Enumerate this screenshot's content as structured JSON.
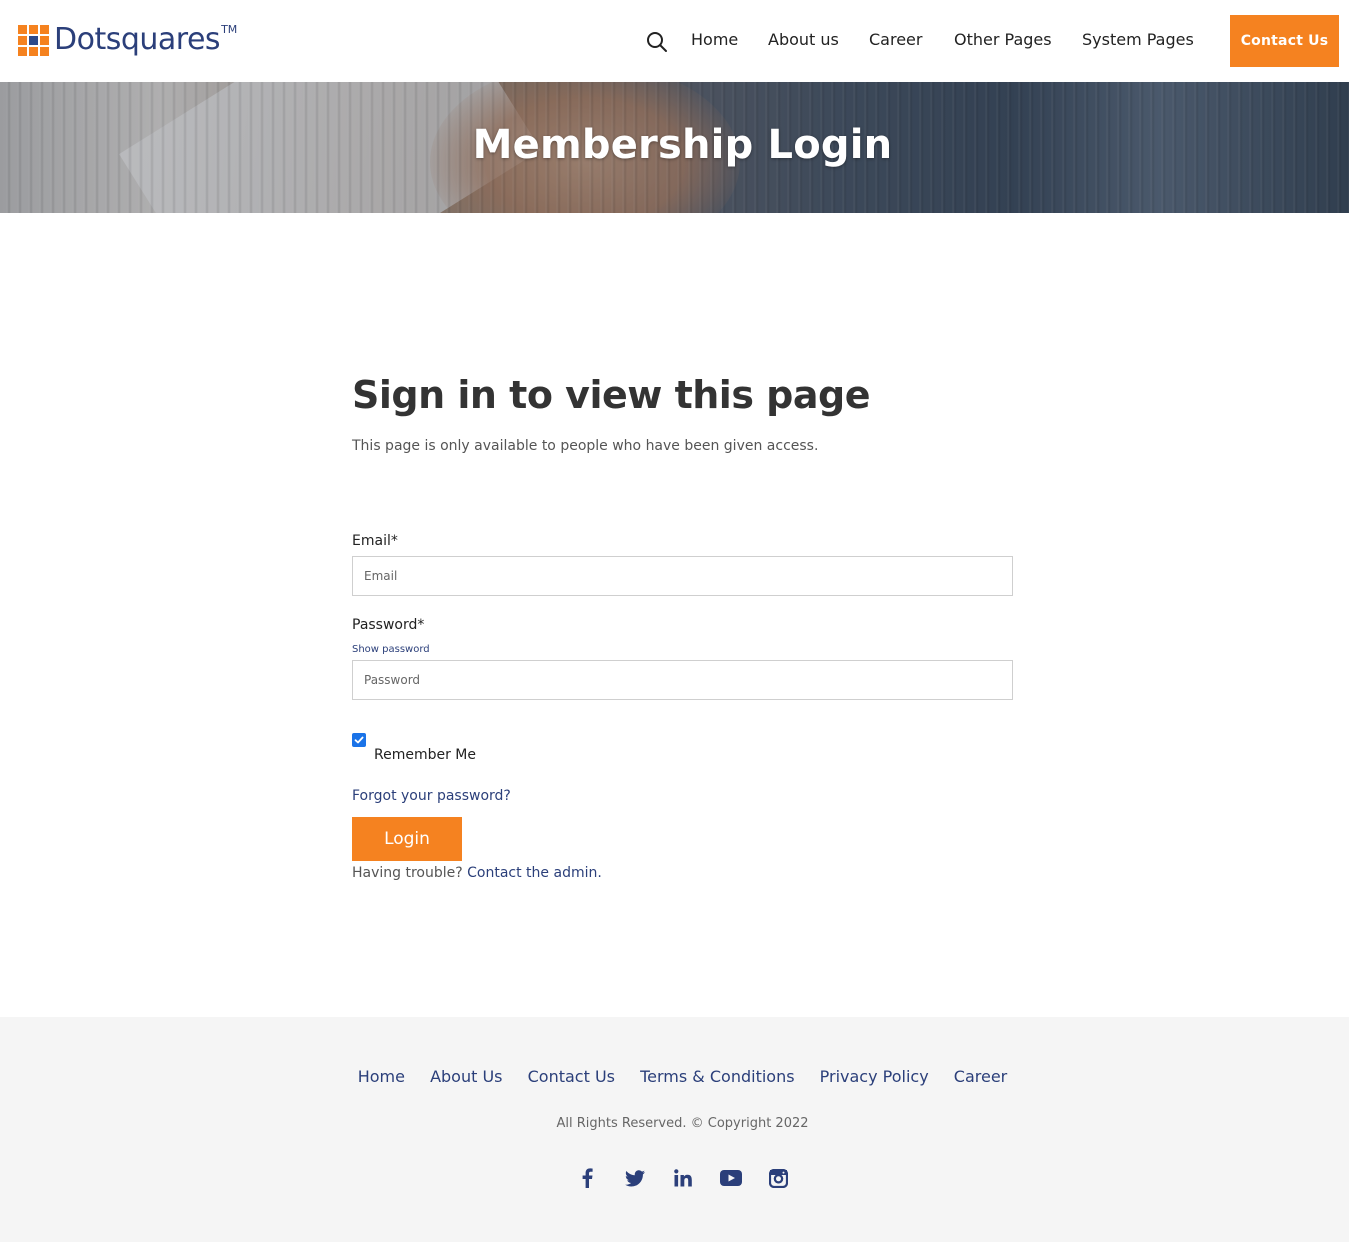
{
  "brand": {
    "name": "Dotsquares",
    "tm": "TM"
  },
  "nav": {
    "items": [
      "Home",
      "About us",
      "Career",
      "Other Pages",
      "System Pages"
    ],
    "contact_label": "Contact Us"
  },
  "banner": {
    "title": "Membership Login"
  },
  "main": {
    "heading": "Sign in to view this page",
    "subtext": "This page is only available to people who have been given access.",
    "email_label": "Email*",
    "email_placeholder": "Email",
    "password_label": "Password*",
    "show_password": "Show password",
    "password_placeholder": "Password",
    "remember_label": "Remember Me",
    "remember_checked": true,
    "forgot_label": "Forgot your password?",
    "login_label": "Login",
    "trouble_text": "Having trouble?",
    "contact_admin": "Contact the admin."
  },
  "footer": {
    "links": [
      "Home",
      "About Us",
      "Contact Us",
      "Terms & Conditions",
      "Privacy Policy",
      "Career"
    ],
    "copyright": "All Rights Reserved. © Copyright 2022",
    "social": [
      "facebook-icon",
      "twitter-icon",
      "linkedin-icon",
      "youtube-icon",
      "instagram-icon"
    ]
  },
  "colors": {
    "accent": "#f58220",
    "brand_blue": "#2b3f7a",
    "checkbox": "#1a73e8"
  }
}
